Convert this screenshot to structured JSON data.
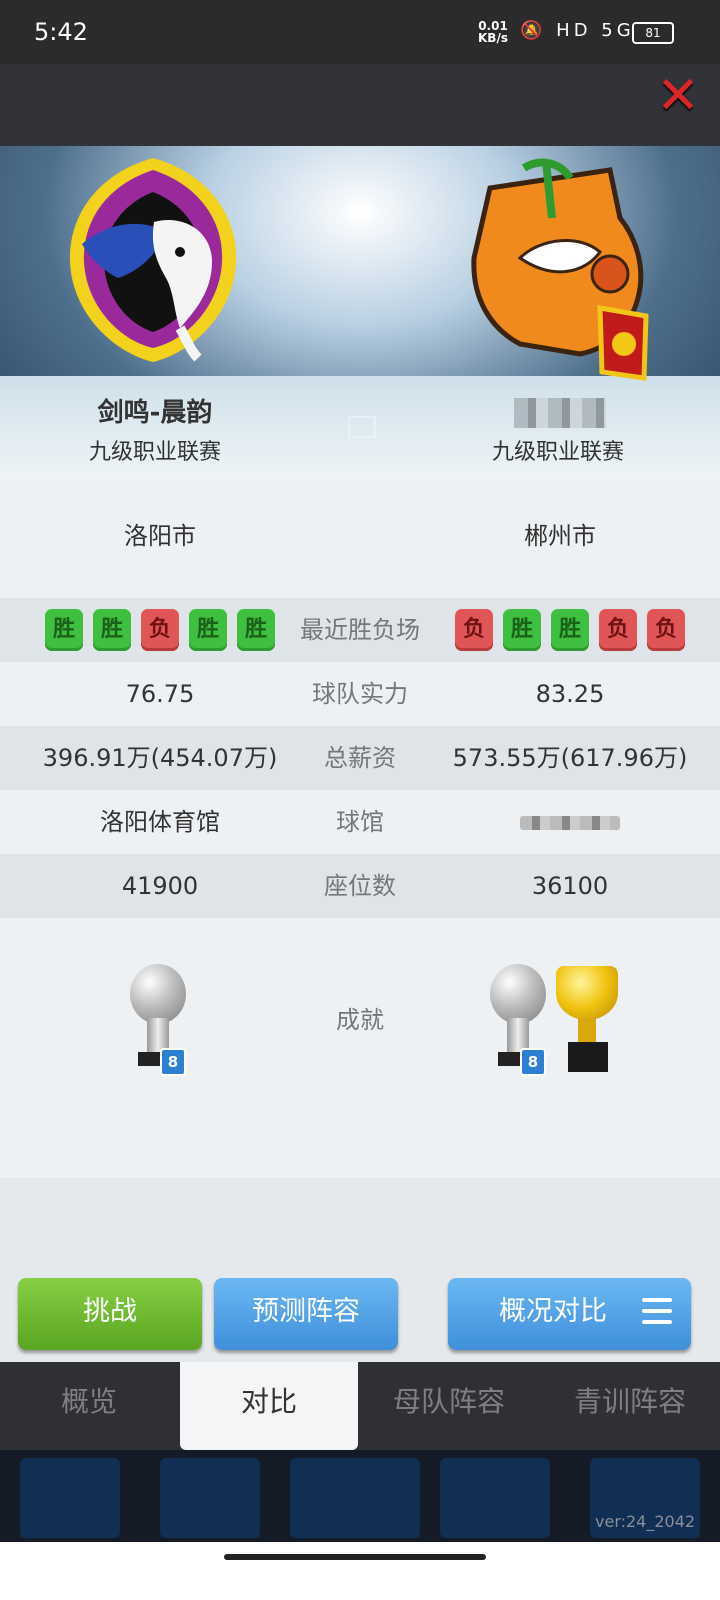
{
  "status_bar": {
    "time": "5:42",
    "net_speed": "0.01",
    "net_unit": "KB/s",
    "icons": "HD 5G",
    "battery": "81"
  },
  "home_team": {
    "name": "剑鸣-晨韵",
    "league": "九级职业联赛",
    "city": "洛阳市",
    "strength": "76.75",
    "salary": "396.91万(454.07万)",
    "arena": "洛阳体育馆",
    "seats": "41900",
    "recent": [
      "胜",
      "胜",
      "负",
      "胜",
      "胜"
    ],
    "trophy_badge": "8"
  },
  "away_team": {
    "league": "九级职业联赛",
    "city": "郴州市",
    "strength": "83.25",
    "salary": "573.55万(617.96万)",
    "seats": "36100",
    "recent": [
      "负",
      "胜",
      "胜",
      "负",
      "负"
    ],
    "trophy_badge": "8"
  },
  "labels": {
    "recent": "最近胜负场",
    "strength": "球队实力",
    "salary": "总薪资",
    "arena": "球馆",
    "seats": "座位数",
    "achievements": "成就"
  },
  "buttons": {
    "challenge": "挑战",
    "predict": "预测阵容",
    "compare": "概况对比"
  },
  "tabs": [
    {
      "label": "概览"
    },
    {
      "label": "对比"
    },
    {
      "label": "母队阵容"
    },
    {
      "label": "青训阵容"
    }
  ],
  "version": "ver:24_2042",
  "colors": {
    "win": "#3fbf3f",
    "loss": "#e05656",
    "green_button": "#5aa521",
    "blue_button": "#3f8fda",
    "close": "#d8262a"
  }
}
